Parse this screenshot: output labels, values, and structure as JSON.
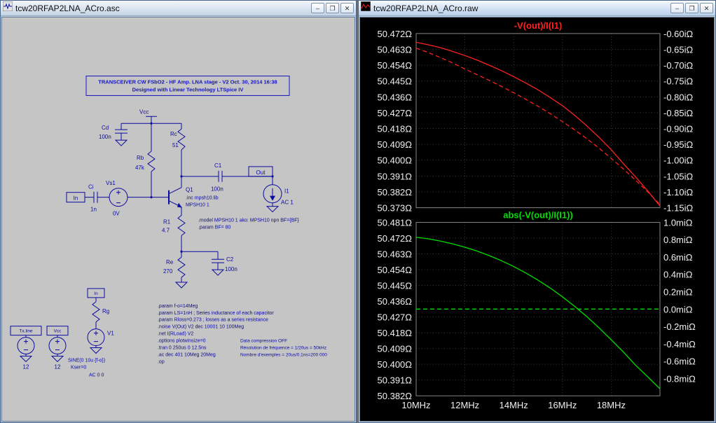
{
  "window_buttons": {
    "minimize": "–",
    "maximize": "❐",
    "close": "✕"
  },
  "left_window": {
    "title": "tcw20RFAP2LNA_ACro.asc",
    "schematic": {
      "header": [
        "TRANSCEIVER CW FSbO2 - HF Amp. LNA stage - V2 Oct. 30, 2014 16:38",
        "Designed with Linear Technology LTSpice IV"
      ],
      "vcc_label": "Vcc",
      "cd_name": "Cd",
      "cd_value": "100n",
      "rc_name": "Rc",
      "rc_value": "51",
      "rb_name": "Rb",
      "rb_value": "47k",
      "q1_name": "Q1",
      "q1_inc": ".inc mpsh10.lib",
      "q1_type": "MPSH10 1",
      "c1_name": "C1",
      "c1_value": "100n",
      "out_port": "Out",
      "i1_name": "I1",
      "i1_value": "AC 1",
      "vs1_name": "Vs1",
      "vs1_value": "0V",
      "ci_name": "Ci",
      "ci_value": "1n",
      "in_port": "In",
      "r1_name": "R1",
      "r1_value": "4.7",
      "re_name": "Re",
      "re_value": "270",
      "c2_name": "C2",
      "c2_value": "100n",
      "model_lines": [
        ".model MPSH10 1 ako: MPSH10 npn BF={BF}",
        ".param BF= 80"
      ],
      "src_tx_flag": "Tx.line",
      "src_tx_value": "12",
      "src_vcc_flag": "Vcc",
      "src_vcc_value": "12",
      "rg_name": "Rg",
      "src_v1_flag": "In",
      "src_v1_name": "V1",
      "src_v1_lines": [
        "SINE(0 10u {f-o})",
        "Kser=0",
        "AC 0 0"
      ],
      "directives": [
        ".param f-o=14Meg",
        ".param LS=1nH      ; Series inductance of each capacitor",
        ".param Rloss=0.273   ; losses as a series resistance",
        ".noise V(Out) V2 dec 10001 10 100Meg",
        ".net I(RLoad) V2",
        ".options plotwinsize=0",
        ".tran 0 250us 0 12.5ns",
        ".ac dec 401 10Meg 20Meg",
        ".op"
      ],
      "notes": [
        "Data compression OFF",
        "Résolution de fréquence = 1/20us = 50kHz",
        "Nombre d'exemples = 20us/0.1ns=200 000"
      ]
    }
  },
  "right_window": {
    "title": "tcw20RFAP2LNA_ACro.raw"
  },
  "chart_data": [
    {
      "type": "line",
      "title": "-V(out)/I(I1)",
      "title_color": "#ff2020",
      "x_axis": {
        "lim": [
          10,
          20
        ],
        "tick_values": [
          10,
          12,
          14,
          16,
          18
        ],
        "tick_labels": [
          "10MHz",
          "12MHz",
          "14MHz",
          "16MHz",
          "18MHz"
        ]
      },
      "left_axis": {
        "lim": [
          50.373,
          50.472
        ],
        "tick_values": [
          50.472,
          50.463,
          50.454,
          50.445,
          50.436,
          50.427,
          50.418,
          50.409,
          50.4,
          50.391,
          50.382,
          50.373
        ],
        "tick_labels": [
          "50.472Ω",
          "50.463Ω",
          "50.454Ω",
          "50.445Ω",
          "50.436Ω",
          "50.427Ω",
          "50.418Ω",
          "50.409Ω",
          "50.400Ω",
          "50.391Ω",
          "50.382Ω",
          "50.373Ω"
        ]
      },
      "right_axis": {
        "lim": [
          -1.15,
          -0.6
        ],
        "tick_values": [
          -0.6,
          -0.65,
          -0.7,
          -0.75,
          -0.8,
          -0.85,
          -0.9,
          -0.95,
          -1.0,
          -1.05,
          -1.1,
          -1.15
        ],
        "tick_labels": [
          "-0.60iΩ",
          "-0.65iΩ",
          "-0.70iΩ",
          "-0.75iΩ",
          "-0.80iΩ",
          "-0.85iΩ",
          "-0.90iΩ",
          "-0.95iΩ",
          "-1.00iΩ",
          "-1.05iΩ",
          "-1.10iΩ",
          "-1.15iΩ"
        ]
      },
      "x": [
        10,
        10.5,
        11,
        11.5,
        12,
        12.5,
        13,
        13.5,
        14,
        14.5,
        15,
        15.5,
        16,
        16.5,
        17,
        17.5,
        18,
        18.5,
        19,
        19.5,
        20
      ],
      "series": [
        {
          "name": "real-part-ohms",
          "axis": "left",
          "line": "solid",
          "color": "#ff2020",
          "values": [
            50.467,
            50.4656,
            50.464,
            50.4618,
            50.4595,
            50.4569,
            50.454,
            50.4509,
            50.4475,
            50.4439,
            50.44,
            50.4356,
            50.431,
            50.4255,
            50.4195,
            50.413,
            50.406,
            50.398,
            50.3905,
            50.3825,
            50.374
          ]
        },
        {
          "name": "imaginary-part-iohms",
          "axis": "right",
          "line": "dashed",
          "color": "#ff2020",
          "values": [
            -0.646,
            -0.66,
            -0.676,
            -0.693,
            -0.712,
            -0.73,
            -0.748,
            -0.767,
            -0.787,
            -0.808,
            -0.83,
            -0.853,
            -0.878,
            -0.904,
            -0.932,
            -0.962,
            -0.994,
            -1.028,
            -1.063,
            -1.1,
            -1.14
          ]
        }
      ]
    },
    {
      "type": "line",
      "title": "abs(-V(out)/I(I1))",
      "title_color": "#00dd00",
      "x_axis": {
        "lim": [
          10,
          20
        ],
        "tick_values": [
          10,
          12,
          14,
          16,
          18
        ],
        "tick_labels": [
          "10MHz",
          "12MHz",
          "14MHz",
          "16MHz",
          "18MHz"
        ]
      },
      "left_axis": {
        "lim": [
          50.382,
          50.481
        ],
        "tick_values": [
          50.481,
          50.472,
          50.463,
          50.454,
          50.445,
          50.436,
          50.427,
          50.418,
          50.409,
          50.4,
          50.391,
          50.382
        ],
        "tick_labels": [
          "50.481Ω",
          "50.472Ω",
          "50.463Ω",
          "50.454Ω",
          "50.445Ω",
          "50.436Ω",
          "50.427Ω",
          "50.418Ω",
          "50.409Ω",
          "50.400Ω",
          "50.391Ω",
          "50.382Ω"
        ]
      },
      "right_axis": {
        "lim": [
          -1.0,
          1.0
        ],
        "tick_values": [
          1.0,
          0.8,
          0.6,
          0.4,
          0.2,
          0.0,
          -0.2,
          -0.4,
          -0.6,
          -0.8
        ],
        "tick_labels": [
          "1.0miΩ",
          "0.8miΩ",
          "0.6miΩ",
          "0.4miΩ",
          "0.2miΩ",
          "0.0miΩ",
          "-0.2miΩ",
          "-0.4miΩ",
          "-0.6miΩ",
          "-0.8miΩ"
        ]
      },
      "x": [
        10,
        10.5,
        11,
        11.5,
        12,
        12.5,
        13,
        13.5,
        14,
        14.5,
        15,
        15.5,
        16,
        16.5,
        17,
        17.5,
        18,
        18.5,
        19,
        19.5,
        20
      ],
      "series": [
        {
          "name": "magnitude-ohms",
          "axis": "left",
          "line": "solid",
          "color": "#00dd00",
          "values": [
            50.4725,
            50.4716,
            50.4703,
            50.4687,
            50.4668,
            50.4646,
            50.462,
            50.4591,
            50.4558,
            50.4521,
            50.448,
            50.4435,
            50.4385,
            50.4331,
            50.4272,
            50.4208,
            50.414,
            50.407,
            50.3995,
            50.3928,
            50.386
          ]
        },
        {
          "name": "zero-reference",
          "axis": "right",
          "line": "dashed",
          "color": "#00dd00",
          "values": [
            0,
            0,
            0,
            0,
            0,
            0,
            0,
            0,
            0,
            0,
            0,
            0,
            0,
            0,
            0,
            0,
            0,
            0,
            0,
            0,
            0
          ]
        }
      ]
    }
  ]
}
